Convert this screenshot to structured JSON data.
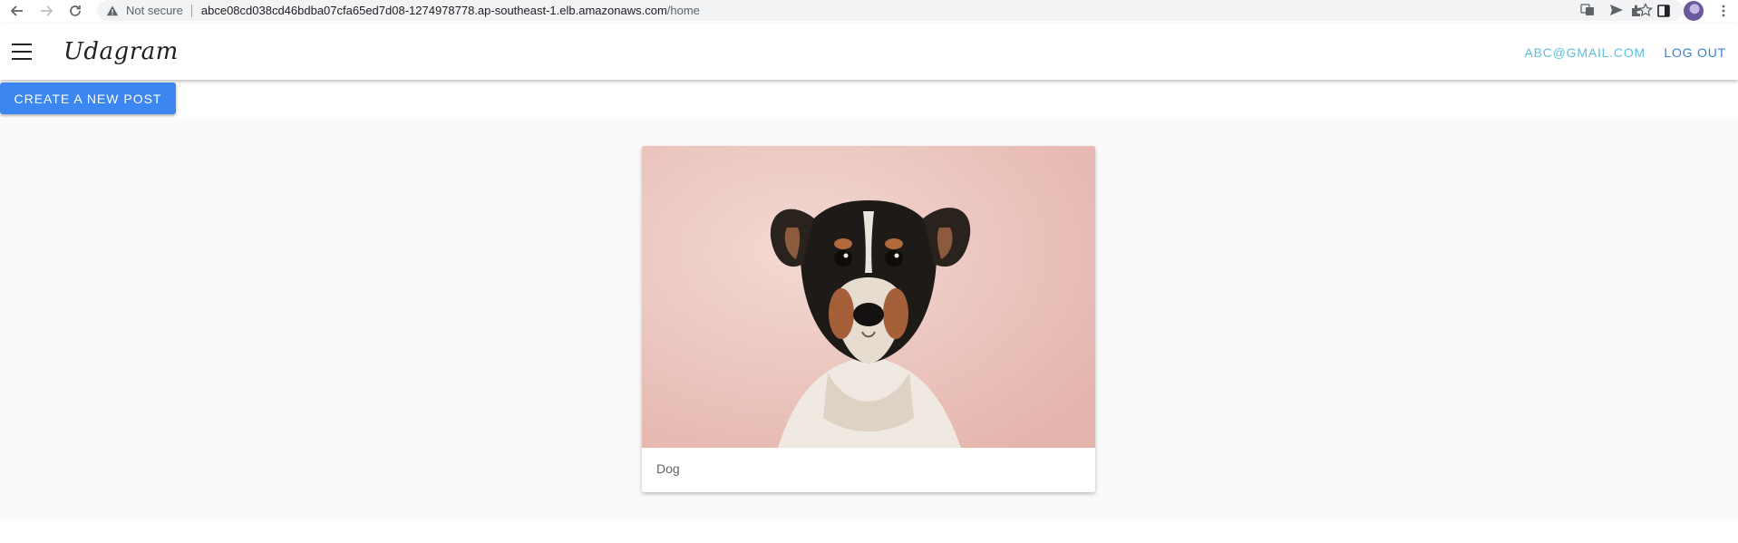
{
  "browser": {
    "security_label": "Not secure",
    "url_host": "abce08cd038cd46bdba07cfa65ed7d08-1274978778.ap-southeast-1.elb.amazonaws.com",
    "url_path": "/home"
  },
  "app_bar": {
    "brand": "Udagram",
    "user_email": "ABC@GMAIL.COM",
    "logout_label": "LOG OUT"
  },
  "actions": {
    "create_post_label": "CREATE A NEW POST"
  },
  "feed": {
    "posts": [
      {
        "caption": "Dog"
      }
    ]
  },
  "colors": {
    "primary_button": "#3b86f0",
    "email_link": "#5bc0de",
    "logout_link": "#3880d6",
    "feed_background": "#fafafa"
  }
}
